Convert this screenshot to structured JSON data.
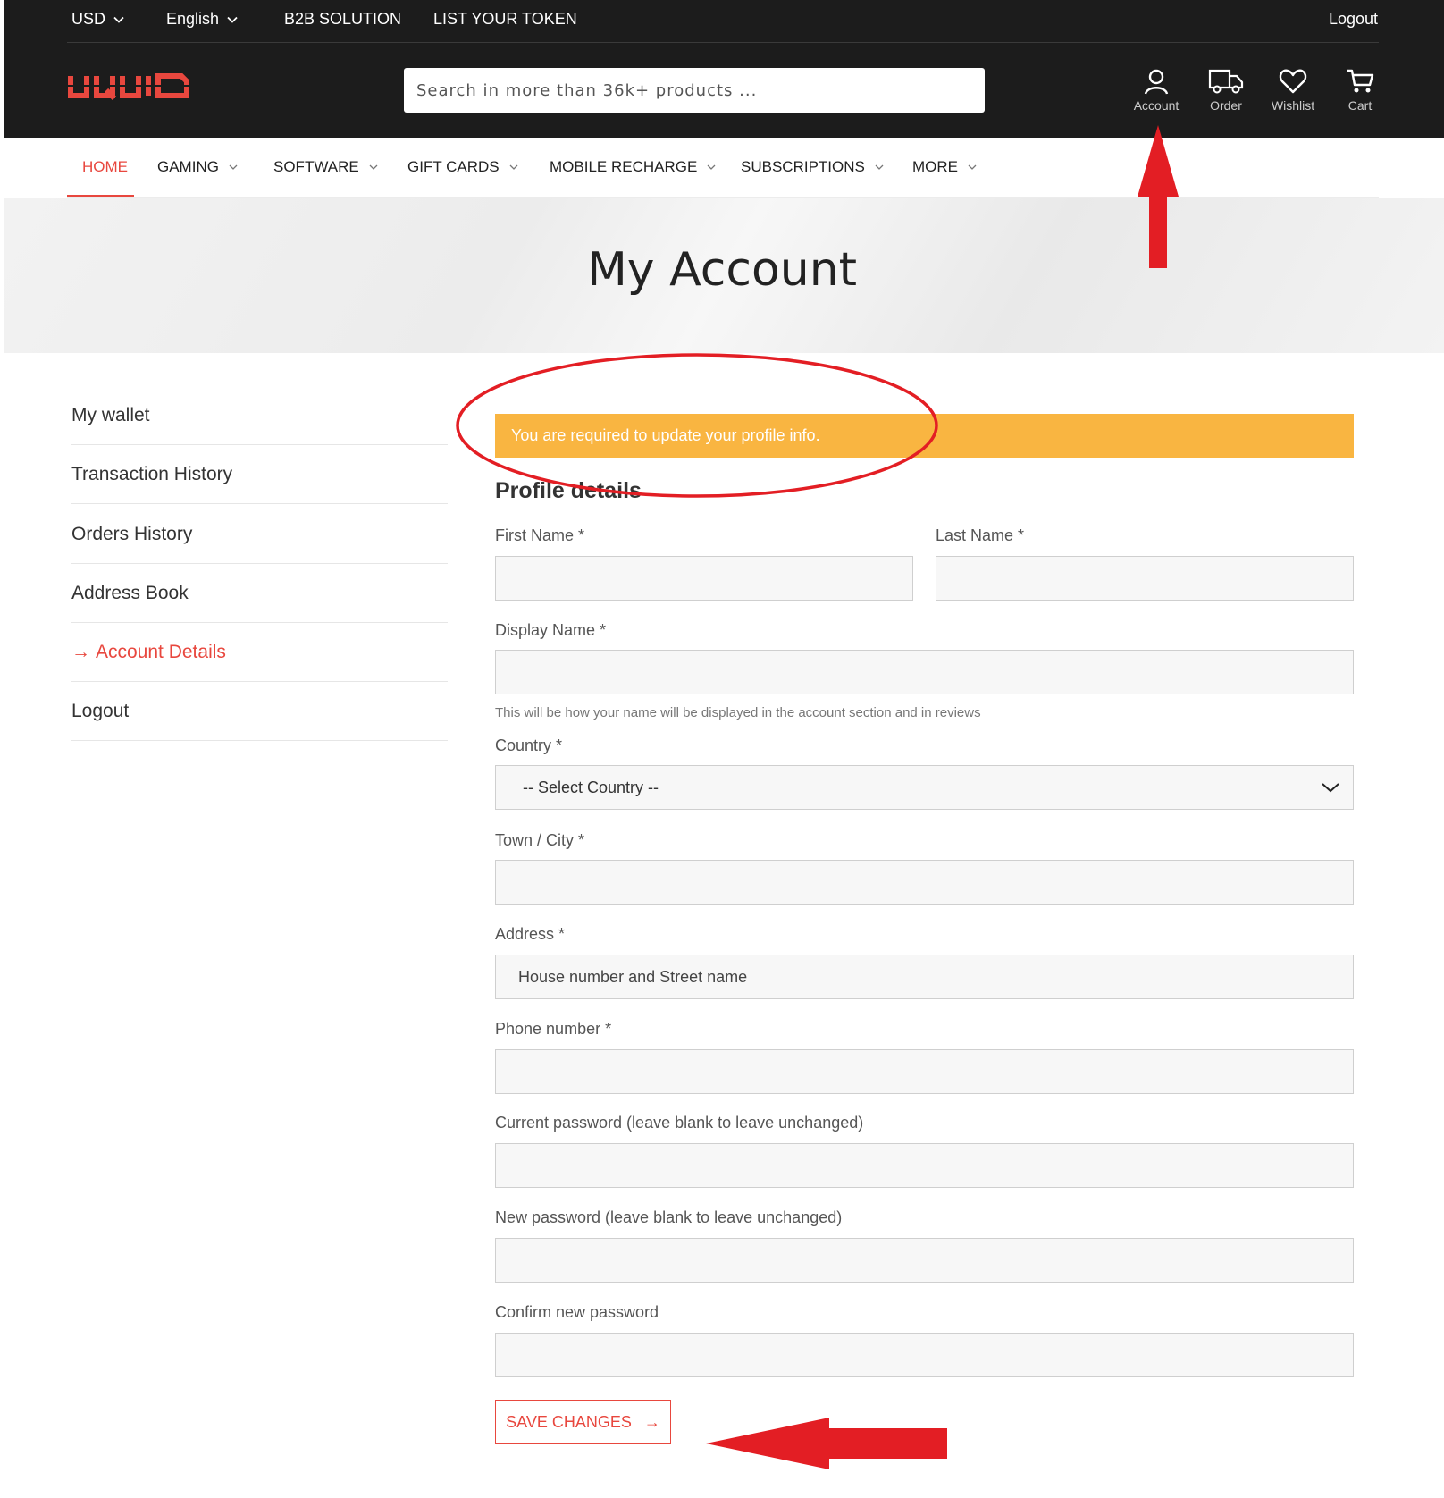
{
  "topbar": {
    "currency": "USD",
    "language": "English",
    "b2b": "B2B SOLUTION",
    "list_token": "LIST YOUR TOKEN",
    "logout": "Logout"
  },
  "brand": {
    "logo_text": "UQUID",
    "accent": "#e8473e"
  },
  "search": {
    "placeholder": "Search in more than 36k+ products ..."
  },
  "header_icons": {
    "account": "Account",
    "order": "Order",
    "wishlist": "Wishlist",
    "cart": "Cart"
  },
  "nav": {
    "home": "HOME",
    "gaming": "GAMING",
    "software": "SOFTWARE",
    "gift_cards": "GIFT CARDS",
    "mobile_recharge": "MOBILE RECHARGE",
    "subscriptions": "SUBSCRIPTIONS",
    "more": "MORE"
  },
  "banner": {
    "title": "My Account"
  },
  "sidebar": {
    "items": [
      "My wallet",
      "Transaction History",
      "Orders History",
      "Address Book",
      "Account Details",
      "Logout"
    ],
    "active_arrow": "→"
  },
  "alert": {
    "text": "You are required to update your profile info.",
    "color": "#f9b541"
  },
  "form": {
    "title": "Profile details",
    "first_name_label": "First Name *",
    "last_name_label": "Last Name *",
    "display_name_label": "Display Name *",
    "display_name_hint": "This will be how your name will be displayed in the account section and in reviews",
    "country_label": "Country *",
    "country_value": "-- Select Country --",
    "city_label": "Town / City *",
    "address_label": "Address *",
    "address_placeholder": "House number and Street name",
    "phone_label": "Phone number *",
    "current_password_label": "Current password (leave blank to leave unchanged)",
    "new_password_label": "New password (leave blank to leave unchanged)",
    "confirm_password_label": "Confirm new password",
    "save_label": "SAVE CHANGES",
    "save_arrow": "→"
  }
}
